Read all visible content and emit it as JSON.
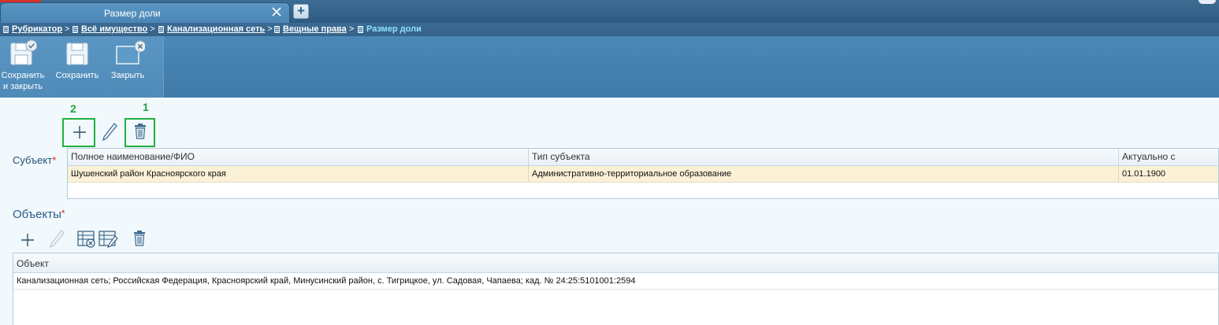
{
  "tab": {
    "title": "Размер доли",
    "new_tab_label": "+"
  },
  "breadcrumb": {
    "items": [
      "Рубрикатор",
      "Всё имущество",
      "Канализационная сеть",
      "Вещные права"
    ],
    "separator": ">",
    "current": "Размер доли"
  },
  "toolbar": {
    "save_close_line1": "Сохранить",
    "save_close_line2": "и закрыть",
    "save": "Сохранить",
    "close": "Закрыть"
  },
  "annotations": {
    "badge_1": "1",
    "badge_2": "2"
  },
  "subject": {
    "label": "Субъект",
    "required_mark": "*",
    "columns": [
      "Полное наименование/ФИО",
      "Тип субъекта",
      "Актуально с"
    ],
    "rows": [
      [
        "Шушенский район Красноярского края",
        "Административно-территориальное образование",
        "01.01.1900"
      ]
    ]
  },
  "objects": {
    "title": "Объекты",
    "required_mark": "*",
    "columns": [
      "Объект"
    ],
    "rows": [
      [
        "Канализационная сеть; Российская Федерация, Красноярский край, Минусинский район, с. Тигрицкое, ул. Садовая, Чапаева; кад. № 24:25:5101001:2594"
      ]
    ]
  },
  "colors": {
    "accent": "#4a86b6",
    "header_dark": "#2e5a80",
    "highlight_green": "#22b03c",
    "selected_row": "#fbf1d6",
    "required": "#e02020"
  },
  "icons": [
    "close-icon",
    "plus-icon",
    "save-and-close-icon",
    "save-icon",
    "close-window-icon",
    "add-icon",
    "edit-icon",
    "delete-icon",
    "grid-delete-icon",
    "grid-edit-icon",
    "document-icon"
  ]
}
